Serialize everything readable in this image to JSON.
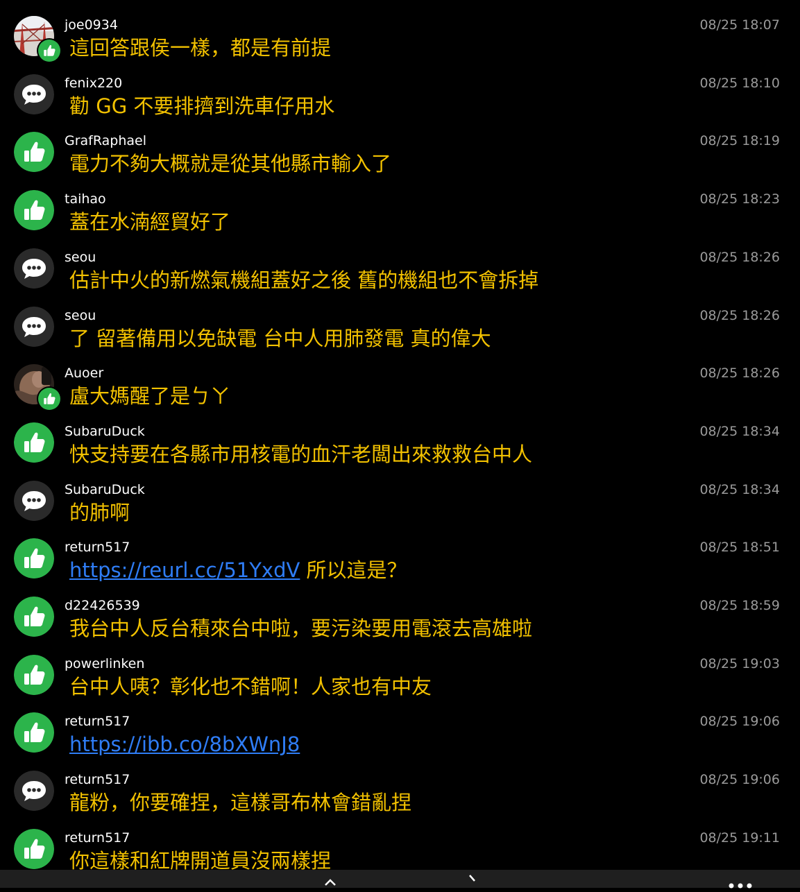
{
  "colors": {
    "background": "#000000",
    "username": "#ffffff",
    "timestamp": "#9a9a9a",
    "message": "#f2c100",
    "link": "#2f7df6",
    "push_icon": "#2cb44b",
    "comment_icon": "#2a2a2a"
  },
  "comments": [
    {
      "type": "photo-push",
      "user": "joe0934",
      "time": "08/25 18:07",
      "text": "這回答跟侯一樣，都是有前提",
      "link": ""
    },
    {
      "type": "neutral",
      "user": "fenix220",
      "time": "08/25 18:10",
      "text": "勸 GG 不要排擠到洗車仔用水",
      "link": ""
    },
    {
      "type": "push",
      "user": "GrafRaphael",
      "time": "08/25 18:19",
      "text": "電力不夠大概就是從其他縣市輸入了",
      "link": ""
    },
    {
      "type": "push",
      "user": "taihao",
      "time": "08/25 18:23",
      "text": "蓋在水湳經貿好了",
      "link": ""
    },
    {
      "type": "neutral",
      "user": "seou",
      "time": "08/25 18:26",
      "text": "估計中火的新燃氣機組蓋好之後 舊的機組也不會拆掉",
      "link": ""
    },
    {
      "type": "neutral",
      "user": "seou",
      "time": "08/25 18:26",
      "text": "了 留著備用以免缺電 台中人用肺發電 真的偉大",
      "link": ""
    },
    {
      "type": "photo-push",
      "user": "Auoer",
      "time": "08/25 18:26",
      "text": "盧大媽醒了是ㄅㄚ",
      "link": ""
    },
    {
      "type": "push",
      "user": "SubaruDuck",
      "time": "08/25 18:34",
      "text": "快支持要在各縣市用核電的血汗老闆出來救救台中人",
      "link": ""
    },
    {
      "type": "neutral",
      "user": "SubaruDuck",
      "time": "08/25 18:34",
      "text": "的肺啊",
      "link": ""
    },
    {
      "type": "push",
      "user": "return517",
      "time": "08/25 18:51",
      "text": " 所以這是？",
      "link": "https://reurl.cc/51YxdV"
    },
    {
      "type": "push",
      "user": "d22426539",
      "time": "08/25 18:59",
      "text": "我台中人反台積來台中啦，要污染要用電滾去高雄啦",
      "link": ""
    },
    {
      "type": "push",
      "user": "powerlinken",
      "time": "08/25 19:03",
      "text": "台中人咦？彰化也不錯啊！人家也有中友",
      "link": ""
    },
    {
      "type": "push",
      "user": "return517",
      "time": "08/25 19:06",
      "text": "",
      "link": "https://ibb.co/8bXWnJ8"
    },
    {
      "type": "neutral",
      "user": "return517",
      "time": "08/25 19:06",
      "text": "龍粉，你要確捏，這樣哥布林會錯亂捏",
      "link": ""
    },
    {
      "type": "push",
      "user": "return517",
      "time": "08/25 19:11",
      "text": "你這樣和紅牌開道員沒兩樣捏",
      "link": ""
    }
  ],
  "bottom_bar": {
    "icons": [
      "up-icon",
      "next-icon",
      "more-icon"
    ]
  }
}
